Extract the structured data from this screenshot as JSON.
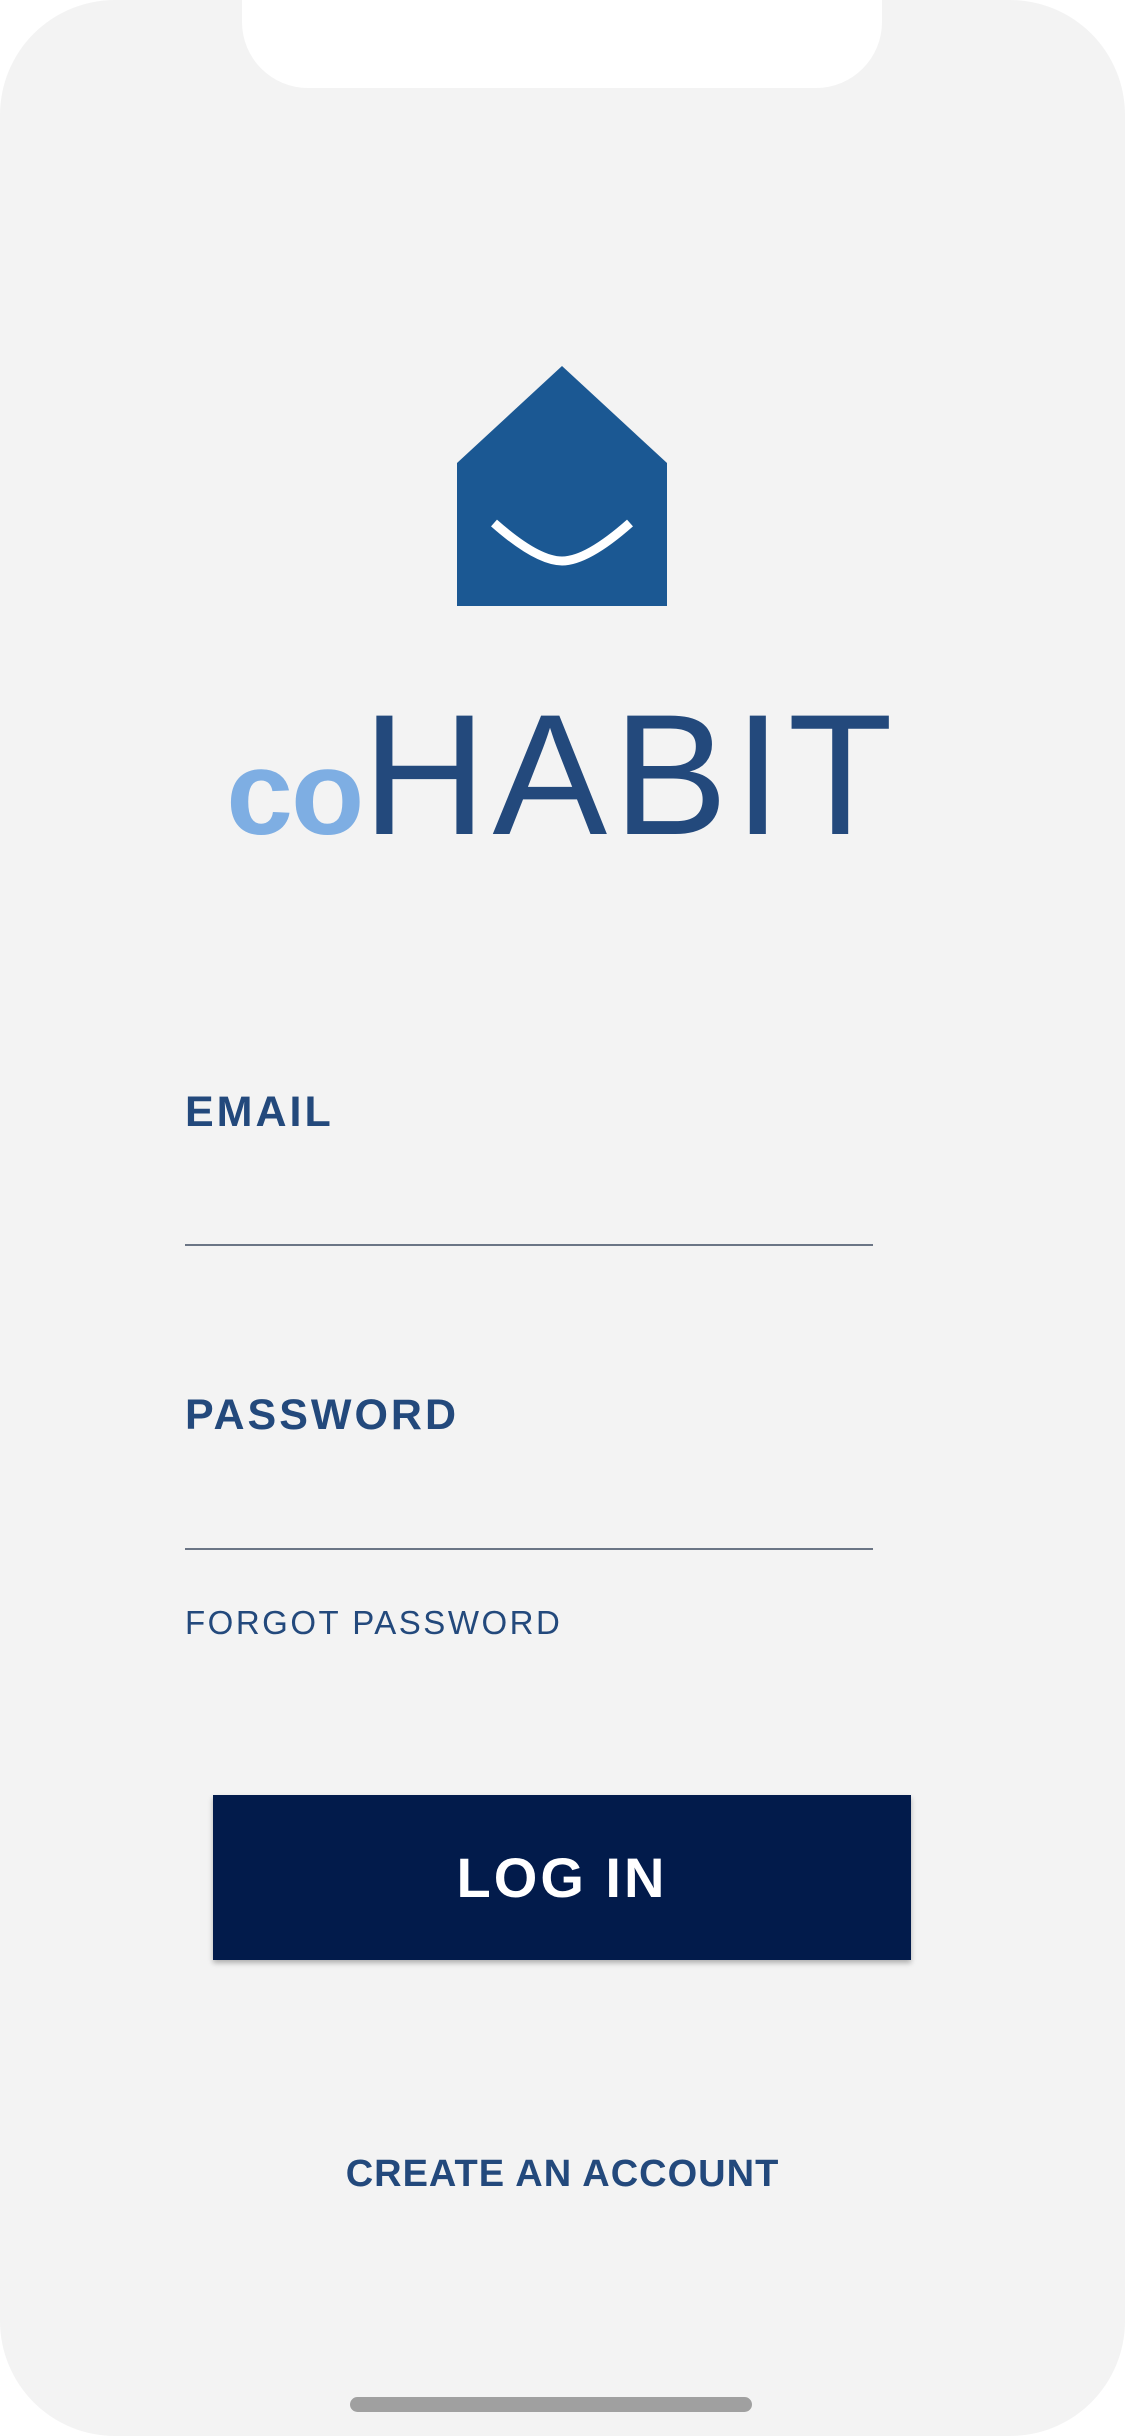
{
  "brand": {
    "prefix": "co",
    "name": "HABIT",
    "icon": "house-smile-icon",
    "colors": {
      "primary": "#23497c",
      "accent": "#7eaee3",
      "icon_fill": "#1b5893",
      "button": "#021b4b",
      "background": "#f3f3f3"
    }
  },
  "form": {
    "email_label": "EMAIL",
    "email_value": "",
    "password_label": "PASSWORD",
    "password_value": "",
    "forgot_password": "FORGOT PASSWORD",
    "login_button": "LOG IN"
  },
  "footer": {
    "create_account": "CREATE AN ACCOUNT"
  }
}
